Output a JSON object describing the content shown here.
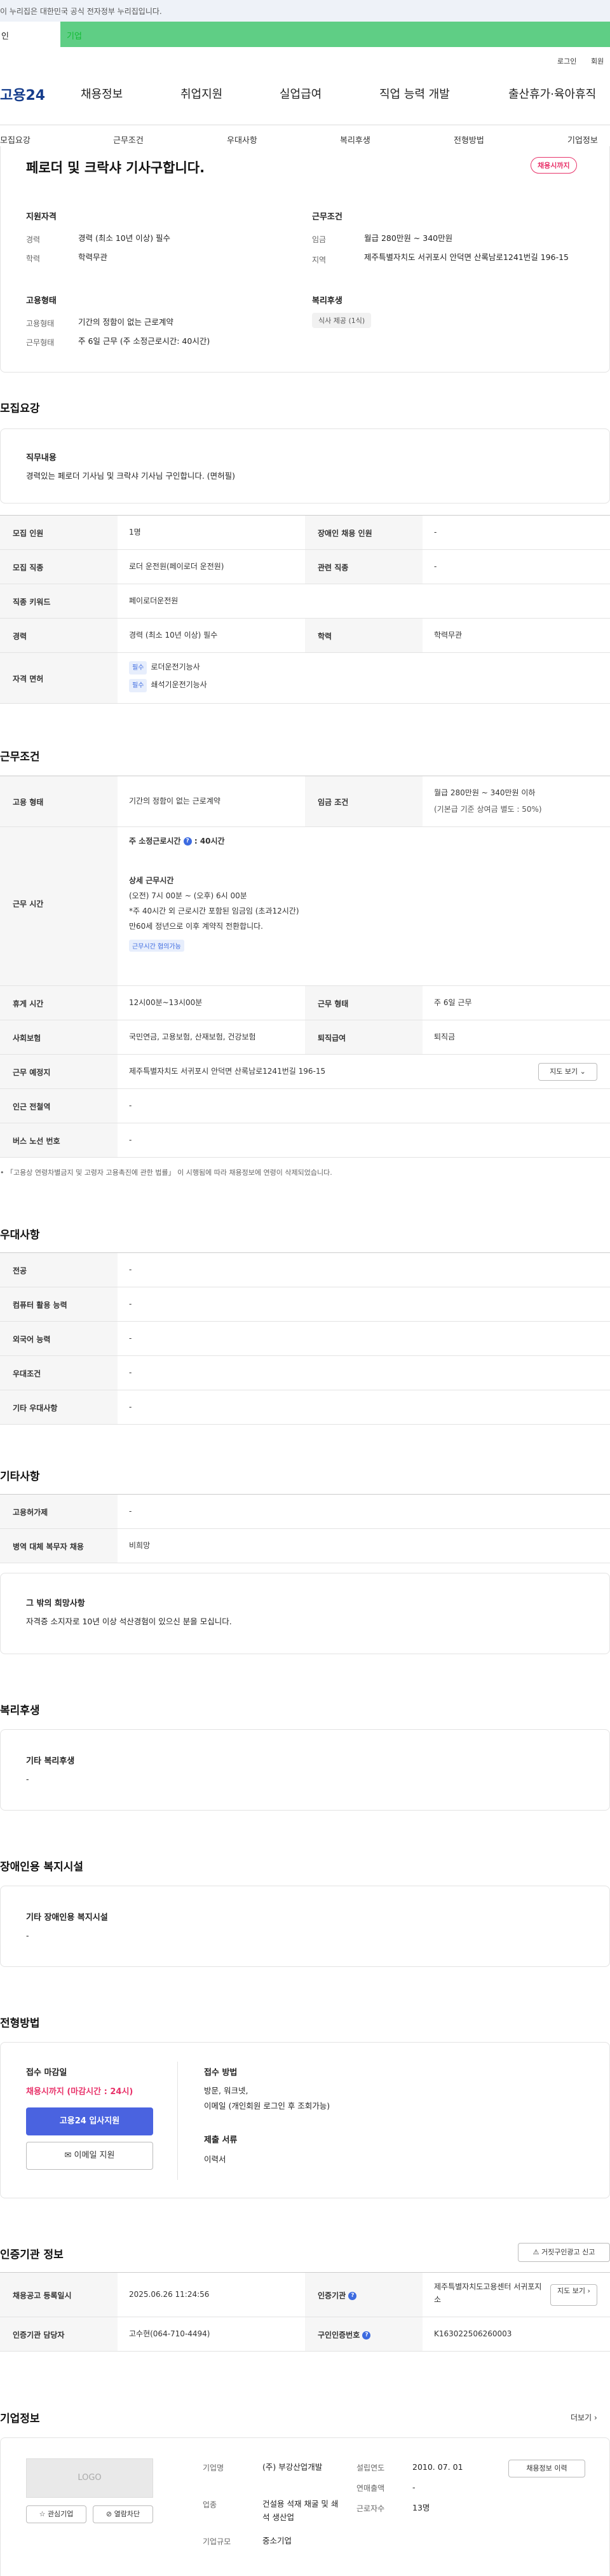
{
  "site": {
    "notice": "이 누리집은 대한민국 공식 전자정부 누리집입니다.",
    "gov_label": "인",
    "banner_label": "기업",
    "logo": "고용24",
    "utils": [
      "로그인",
      "회원"
    ],
    "gnb": [
      "채용정보",
      "취업지원",
      "실업급여",
      "직업 능력 개발",
      "출산휴가·육아휴직"
    ]
  },
  "tabs": [
    "모집요강",
    "근무조건",
    "우대사항",
    "복리후생",
    "전형방법",
    "기업정보"
  ],
  "summary": {
    "title": "페로더 및 크락샤 기사구합니다.",
    "status_badge": "채용시까지",
    "qualification_title": "지원자격",
    "career_key": "경력",
    "career_val": "경력 (최소 10년 이상) 필수",
    "edu_key": "학력",
    "edu_val": "학력무관",
    "cond_title": "근무조건",
    "wage_key": "임금",
    "wage_val": "월급 280만원 ~ 340만원",
    "region_key": "지역",
    "region_val": "제주특별자치도 서귀포시 안덕면 산록남로1241번길 196-15",
    "emp_title": "고용형태",
    "emptype_key": "고용형태",
    "emptype_val": "기간의 정함이 없는 근로계약",
    "worktype_key": "근무형태",
    "worktype_val": "주 6일 근무 (주 소정근로시간: 40시간)",
    "welfare_title": "복리후생",
    "welfare_chip": "식사 제공 (1식)"
  },
  "recruit": {
    "title": "모집요강",
    "duty_title": "직무내용",
    "duty_text": "경력있는 페로더 기사님 및 크락샤 기사님 구인합니다. (면허필)",
    "rows": [
      {
        "k1": "모집 인원",
        "v1": "1명",
        "k2": "장애인 채용 인원",
        "v2": "-"
      },
      {
        "k1": "모집 직종",
        "v1": "로더 운전원(페이로더 운전원)",
        "k2": "관련 직종",
        "v2": "-"
      },
      {
        "k1": "직종 키워드",
        "v1": "페이로더운전원",
        "k2": "",
        "v2": ""
      },
      {
        "k1": "경력",
        "v1": "경력 (최소 10년 이상) 필수",
        "k2": "학력",
        "v2": "학력무관"
      }
    ],
    "license_key": "자격 면허",
    "licenses": [
      {
        "tag": "필수",
        "name": "로더운전기능사"
      },
      {
        "tag": "필수",
        "name": "쇄석기운전기능사"
      }
    ]
  },
  "work": {
    "title": "근무조건",
    "emptype_key": "고용 형태",
    "emptype_val": "기간의 정함이 없는 근로계약",
    "wage_key": "임금 조건",
    "wage_val": "월급 280만원 ~ 340만원 이하",
    "wage_sub": "(기본급 기준 상여금 별도 : 50%)",
    "hours_key": "근무 시간",
    "hours_title": "주 소정근로시간",
    "hours_value": ": 40시간",
    "hours_detail_title": "상세 근무시간",
    "hours_lines": [
      "(오전) 7시 00분 ~ (오후) 6시 00분",
      "*주 40시간 외 근로시간 포함된 임금임 (초과12시간)",
      "만60세 정년으로 이후 계약직 전환합니다."
    ],
    "hours_chip": "근무시간 협의가능",
    "rows": [
      {
        "k1": "휴게 시간",
        "v1": "12시00분~13시00분",
        "k2": "근무 형태",
        "v2": "주 6일 근무"
      },
      {
        "k1": "사회보험",
        "v1": "국민연금, 고용보험, 산재보험, 건강보험",
        "k2": "퇴직급여",
        "v2": "퇴직금"
      }
    ],
    "place_key": "근무 예정지",
    "place_val": "제주특별자치도 서귀포시 안덕면 산록남로1241번길 196-15",
    "map_button": "지도 보기",
    "station_key": "인근 전철역",
    "station_val": "-",
    "bus_key": "버스 노선 번호",
    "bus_val": "-",
    "footnote": "「고용상 연령차별금지 및 고령자 고용촉진에 관한 법률」 이 시행됨에 따라 채용정보에 연령이 삭제되었습니다."
  },
  "preference": {
    "title": "우대사항",
    "rows": [
      {
        "k": "전공",
        "v": "-"
      },
      {
        "k": "컴퓨터 활용 능력",
        "v": "-"
      },
      {
        "k": "외국어 능력",
        "v": "-"
      },
      {
        "k": "우대조건",
        "v": "-"
      },
      {
        "k": "기타 우대사항",
        "v": "-"
      }
    ]
  },
  "other": {
    "title": "기타사항",
    "rows": [
      {
        "k": "고용허가제",
        "v": "-"
      },
      {
        "k": "병역 대체 복무자 채용",
        "v": "비희망"
      }
    ],
    "extra_title": "그 밖의 희망사항",
    "extra_text": "자격증 소지자로 10년 이상 석산경험이 있으신 분을 모십니다."
  },
  "welfare": {
    "title": "복리후생",
    "box_title": "기타 복리후생",
    "box_val": "-"
  },
  "disability": {
    "title": "장애인용 복지시설",
    "box_title": "기타 장애인용 복지시설",
    "box_val": "-"
  },
  "selection": {
    "title": "전형방법",
    "deadline_title": "접수 마감일",
    "deadline_val": "채용시까지 (마감시간 : 24시)",
    "apply_button": "고용24 입사지원",
    "email_button": "이메일 지원",
    "method_title": "접수 방법",
    "method_lines": [
      "방문, 워크넷,",
      "이메일 (개인회원 로그인 후 조회가능)"
    ],
    "docs_title": "제출 서류",
    "docs_val": "이력서"
  },
  "cert": {
    "title": "인증기관 정보",
    "report_button": "거짓구인광고 신고",
    "reg_key": "채용공고 등록일시",
    "reg_val": "2025.06.26 11:24:56",
    "org_key": "인증기관",
    "org_val": "제주특별자치도고용센터 서귀포지소",
    "map_button": "지도 보기",
    "mgr_key": "인증기관 담당자",
    "mgr_val": "고수현(064-710-4494)",
    "num_key": "구인인증번호",
    "num_val": "K163022506260003"
  },
  "company": {
    "title": "기업정보",
    "more": "더보기",
    "logo_text": "LOGO",
    "fav_button": "관심기업",
    "block_button": "열람차단",
    "name_key": "기업명",
    "name_val": "(주) 부강산업개발",
    "industry_key": "업종",
    "industry_val": "건설용 석재 채굴 및 쇄석 생산업",
    "size_key": "기업규모",
    "size_val": "중소기업",
    "founded_key": "설립연도",
    "founded_val": "2010. 07. 01",
    "sales_key": "연매출액",
    "sales_val": "-",
    "staff_key": "근로자수",
    "staff_val": "13명",
    "history_button": "채용정보 이력"
  }
}
